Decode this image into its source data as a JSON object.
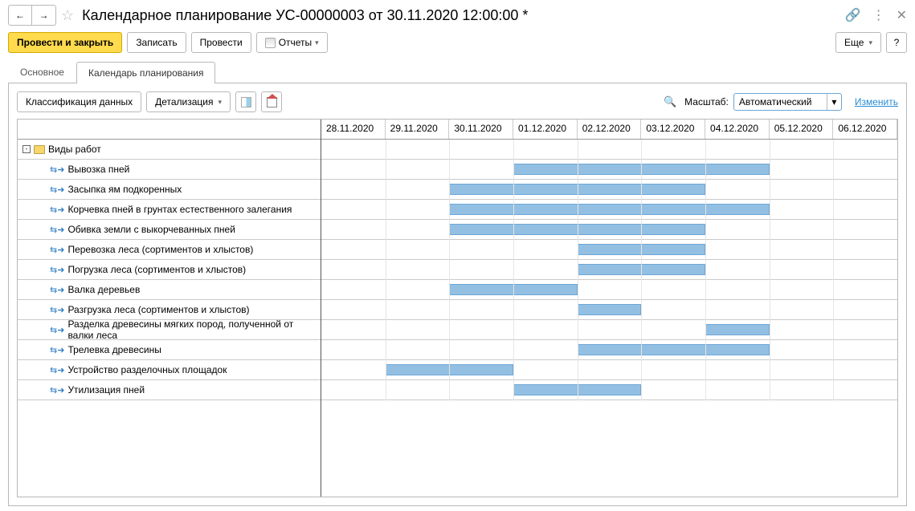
{
  "header": {
    "title": "Календарное планирование УС-00000003 от 30.11.2020 12:00:00 *"
  },
  "toolbar": {
    "post_close": "Провести и закрыть",
    "save": "Записать",
    "post": "Провести",
    "reports": "Отчеты",
    "more": "Еще"
  },
  "tabs": {
    "main": "Основное",
    "planning": "Календарь планирования"
  },
  "sub_toolbar": {
    "data_classification": "Классификация данных",
    "detailing": "Детализация",
    "scale_label": "Масштаб:",
    "scale_value": "Автоматический",
    "change": "Изменить"
  },
  "dates": [
    "28.11.2020",
    "29.11.2020",
    "30.11.2020",
    "01.12.2020",
    "02.12.2020",
    "03.12.2020",
    "04.12.2020",
    "05.12.2020",
    "06.12.2020"
  ],
  "root_task": "Виды работ",
  "tasks": [
    {
      "name": "Вывозка пней",
      "start": 3,
      "end": 7
    },
    {
      "name": "Засыпка ям подкоренных",
      "start": 2,
      "end": 6
    },
    {
      "name": "Корчевка пней в грунтах естественного залегания",
      "start": 2,
      "end": 7
    },
    {
      "name": "Обивка земли с выкорчеванных пней",
      "start": 2,
      "end": 6
    },
    {
      "name": "Перевозка леса (сортиментов и хлыстов)",
      "start": 4,
      "end": 6
    },
    {
      "name": "Погрузка леса (сортиментов и хлыстов)",
      "start": 4,
      "end": 6
    },
    {
      "name": "Валка деревьев",
      "start": 2,
      "end": 4
    },
    {
      "name": "Разгрузка леса (сортиментов и хлыстов)",
      "start": 4,
      "end": 5
    },
    {
      "name": "Разделка древесины мягких пород, полученной от валки леса",
      "start": 6,
      "end": 7
    },
    {
      "name": "Трелевка древесины",
      "start": 4,
      "end": 7
    },
    {
      "name": "Устройство разделочных площадок",
      "start": 1,
      "end": 3
    },
    {
      "name": "Утилизация пней",
      "start": 3,
      "end": 5
    }
  ]
}
